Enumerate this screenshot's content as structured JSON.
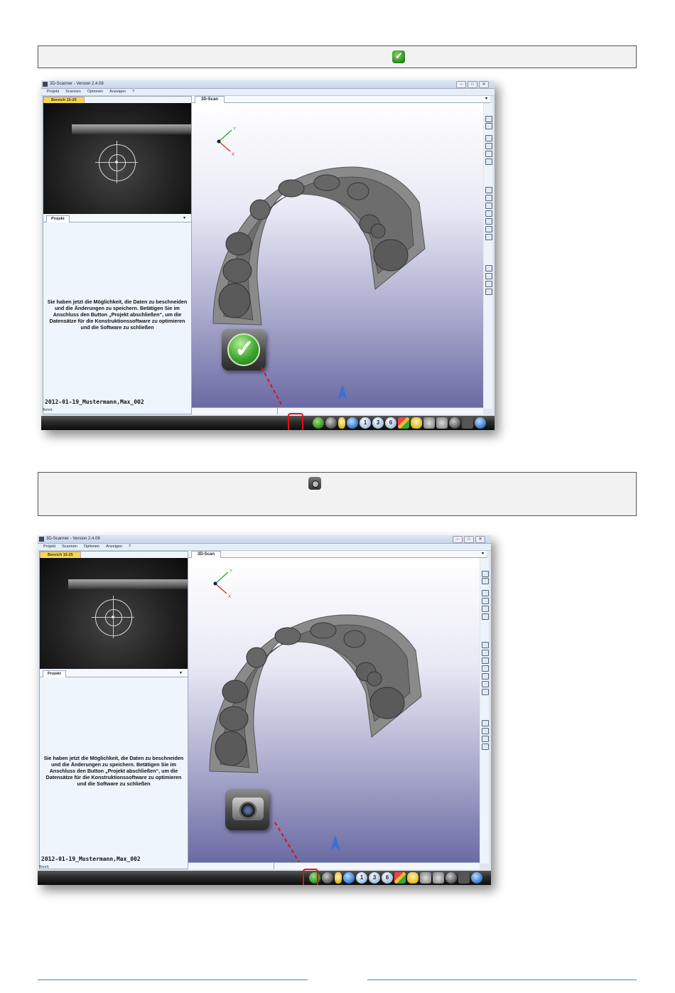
{
  "note_boxes": [
    {
      "icon": "green-check-icon",
      "text": ""
    },
    {
      "icon": "camera-icon",
      "text": ""
    }
  ],
  "app": {
    "window_title": "3D-Scanner - Version 2.4.08",
    "menu": [
      "Projekt",
      "Scannen",
      "Optionen",
      "Anzeigen",
      "?"
    ],
    "window_buttons": [
      "–",
      "□",
      "✕"
    ],
    "camera_tab": "Bereich 15-25",
    "project_panel_title": "Projekt",
    "project_panel_arrow": "▾",
    "project_text": "Sie haben jetzt die Möglichkeit, die Daten zu beschneiden und die Änderungen zu speichern. Betätigen Sie im Anschluss den Button „Projekt abschließen“, um die Datensätze für die Konstruktionssoftware zu optimieren und die Software zu schließen",
    "project_name": "2012-01-19_Mustermann,Max_002",
    "status": "Bereit.",
    "view_tab": "3D-Scan",
    "view_tab_arrow": "▾",
    "axis_labels": {
      "y": "Y",
      "x": "X"
    },
    "toolbar_numbers": [
      "1",
      "3",
      "6"
    ]
  },
  "screenshots": [
    {
      "highlight_button": "finish-project-button",
      "big_icon": "green-check-icon"
    },
    {
      "highlight_button": "camera-button",
      "big_icon": "camera-icon"
    }
  ]
}
